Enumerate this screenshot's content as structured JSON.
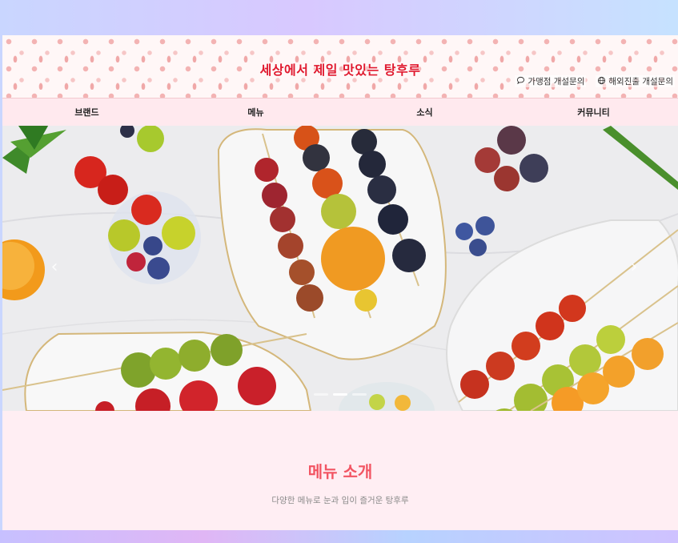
{
  "header": {
    "logo": "세상에서 제일 맛있는 탕후루",
    "utils": [
      {
        "label": "가맹점 개설문의",
        "icon": "chat-icon"
      },
      {
        "label": "해외진출 개설문의",
        "icon": "globe-icon"
      }
    ]
  },
  "nav": {
    "items": [
      "브랜드",
      "메뉴",
      "소식",
      "커뮤니티"
    ]
  },
  "hero": {
    "prev_icon": "chevron-left-icon",
    "next_icon": "chevron-right-icon",
    "slides_count": 3,
    "active_slide": 2
  },
  "intro": {
    "title": "메뉴 소개",
    "subtitle": "다양한 메뉴로 눈과 입이 즐거운 탕후루"
  },
  "colors": {
    "logo": "#e0192e",
    "accent": "#f25563",
    "nav_bg": "#ffe9ee",
    "intro_bg": "#ffeef3"
  }
}
